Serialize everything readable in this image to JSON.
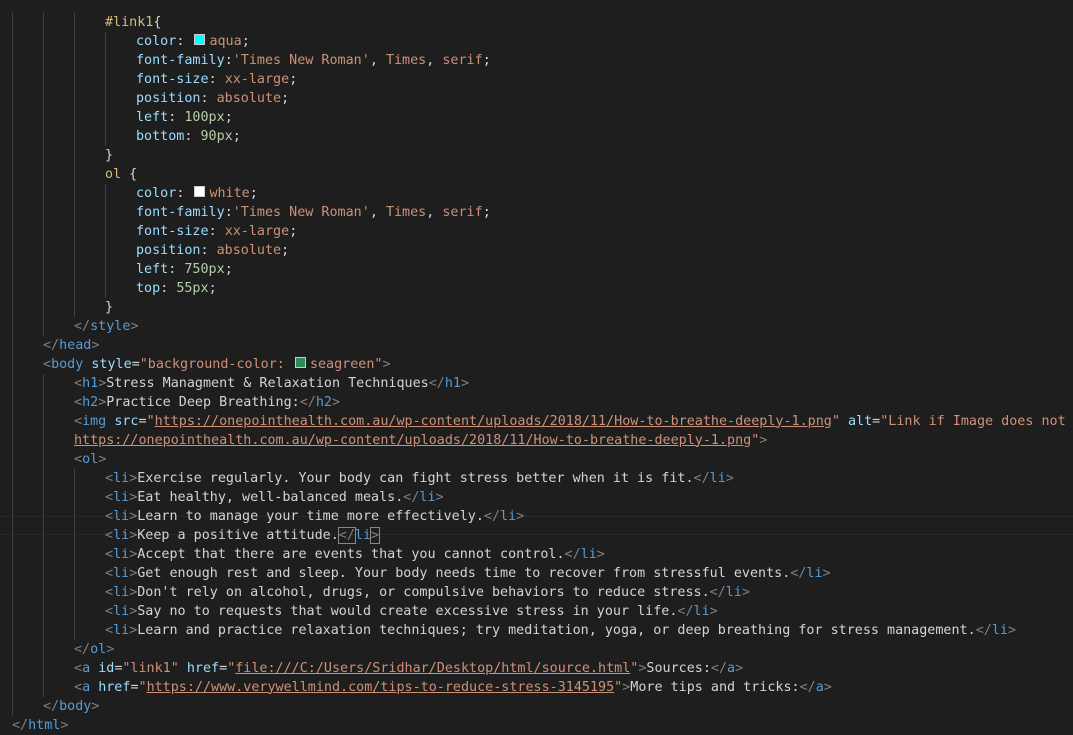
{
  "editor": {
    "lines": [
      {
        "tokens": [
          {
            "t": "#link1",
            "c": "sel"
          },
          {
            "t": "{",
            "c": "txt"
          }
        ]
      },
      {
        "tokens": [
          {
            "t": "color",
            "c": "prop"
          },
          {
            "t": ": ",
            "c": "txt"
          },
          {
            "swatch": "#00ffff"
          },
          {
            "t": "aqua",
            "c": "val"
          },
          {
            "t": ";",
            "c": "txt"
          }
        ]
      },
      {
        "tokens": [
          {
            "t": "font-family",
            "c": "prop"
          },
          {
            "t": ":",
            "c": "txt"
          },
          {
            "t": "'Times New Roman'",
            "c": "str"
          },
          {
            "t": ", ",
            "c": "txt"
          },
          {
            "t": "Times",
            "c": "val"
          },
          {
            "t": ", ",
            "c": "txt"
          },
          {
            "t": "serif",
            "c": "val"
          },
          {
            "t": ";",
            "c": "txt"
          }
        ]
      },
      {
        "tokens": [
          {
            "t": "font-size",
            "c": "prop"
          },
          {
            "t": ": ",
            "c": "txt"
          },
          {
            "t": "xx-large",
            "c": "val"
          },
          {
            "t": ";",
            "c": "txt"
          }
        ]
      },
      {
        "tokens": [
          {
            "t": "position",
            "c": "prop"
          },
          {
            "t": ": ",
            "c": "txt"
          },
          {
            "t": "absolute",
            "c": "val"
          },
          {
            "t": ";",
            "c": "txt"
          }
        ]
      },
      {
        "tokens": [
          {
            "t": "left",
            "c": "prop"
          },
          {
            "t": ": ",
            "c": "txt"
          },
          {
            "t": "100px",
            "c": "num"
          },
          {
            "t": ";",
            "c": "txt"
          }
        ]
      },
      {
        "tokens": [
          {
            "t": "bottom",
            "c": "prop"
          },
          {
            "t": ": ",
            "c": "txt"
          },
          {
            "t": "90px",
            "c": "num"
          },
          {
            "t": ";",
            "c": "txt"
          }
        ]
      },
      {
        "tokens": [
          {
            "t": "}",
            "c": "txt"
          }
        ]
      },
      {
        "tokens": [
          {
            "t": "ol",
            "c": "sel"
          },
          {
            "t": " {",
            "c": "txt"
          }
        ]
      },
      {
        "tokens": [
          {
            "t": "color",
            "c": "prop"
          },
          {
            "t": ": ",
            "c": "txt"
          },
          {
            "swatch": "#ffffff"
          },
          {
            "t": "white",
            "c": "val"
          },
          {
            "t": ";",
            "c": "txt"
          }
        ]
      },
      {
        "tokens": [
          {
            "t": "font-family",
            "c": "prop"
          },
          {
            "t": ":",
            "c": "txt"
          },
          {
            "t": "'Times New Roman'",
            "c": "str"
          },
          {
            "t": ", ",
            "c": "txt"
          },
          {
            "t": "Times",
            "c": "val"
          },
          {
            "t": ", ",
            "c": "txt"
          },
          {
            "t": "serif",
            "c": "val"
          },
          {
            "t": ";",
            "c": "txt"
          }
        ]
      },
      {
        "tokens": [
          {
            "t": "font-size",
            "c": "prop"
          },
          {
            "t": ": ",
            "c": "txt"
          },
          {
            "t": "xx-large",
            "c": "val"
          },
          {
            "t": ";",
            "c": "txt"
          }
        ]
      },
      {
        "tokens": [
          {
            "t": "position",
            "c": "prop"
          },
          {
            "t": ": ",
            "c": "txt"
          },
          {
            "t": "absolute",
            "c": "val"
          },
          {
            "t": ";",
            "c": "txt"
          }
        ]
      },
      {
        "tokens": [
          {
            "t": "left",
            "c": "prop"
          },
          {
            "t": ": ",
            "c": "txt"
          },
          {
            "t": "750px",
            "c": "num"
          },
          {
            "t": ";",
            "c": "txt"
          }
        ]
      },
      {
        "tokens": [
          {
            "t": "top",
            "c": "prop"
          },
          {
            "t": ": ",
            "c": "txt"
          },
          {
            "t": "55px",
            "c": "num"
          },
          {
            "t": ";",
            "c": "txt"
          }
        ]
      },
      {
        "tokens": [
          {
            "t": "}",
            "c": "txt"
          }
        ]
      },
      {
        "tokens": [
          {
            "t": "</",
            "c": "pun"
          },
          {
            "t": "style",
            "c": "tag"
          },
          {
            "t": ">",
            "c": "pun"
          }
        ]
      },
      {
        "tokens": [
          {
            "t": "</",
            "c": "pun"
          },
          {
            "t": "head",
            "c": "tag"
          },
          {
            "t": ">",
            "c": "pun"
          }
        ]
      },
      {
        "tokens": [
          {
            "t": "<",
            "c": "pun"
          },
          {
            "t": "body",
            "c": "tag"
          },
          {
            "t": " ",
            "c": "txt"
          },
          {
            "t": "style",
            "c": "attr"
          },
          {
            "t": "=",
            "c": "txt"
          },
          {
            "t": "\"background-color: ",
            "c": "str"
          },
          {
            "swatch": "#2e8b57"
          },
          {
            "t": "seagreen\"",
            "c": "str"
          },
          {
            "t": ">",
            "c": "pun"
          }
        ]
      },
      {
        "tokens": [
          {
            "t": "<",
            "c": "pun"
          },
          {
            "t": "h1",
            "c": "tag"
          },
          {
            "t": ">",
            "c": "pun"
          },
          {
            "t": "Stress Managment & Relaxation Techniques",
            "c": "txt"
          },
          {
            "t": "</",
            "c": "pun"
          },
          {
            "t": "h1",
            "c": "tag"
          },
          {
            "t": ">",
            "c": "pun"
          }
        ]
      },
      {
        "tokens": [
          {
            "t": "<",
            "c": "pun"
          },
          {
            "t": "h2",
            "c": "tag"
          },
          {
            "t": ">",
            "c": "pun"
          },
          {
            "t": "Practice Deep Breathing:",
            "c": "txt"
          },
          {
            "t": "</",
            "c": "pun"
          },
          {
            "t": "h2",
            "c": "tag"
          },
          {
            "t": ">",
            "c": "pun"
          }
        ]
      },
      {
        "tokens": [
          {
            "t": "<",
            "c": "pun"
          },
          {
            "t": "img",
            "c": "tag"
          },
          {
            "t": " ",
            "c": "txt"
          },
          {
            "t": "src",
            "c": "attr"
          },
          {
            "t": "=",
            "c": "txt"
          },
          {
            "t": "\"",
            "c": "str"
          },
          {
            "t": "https://onepointhealth.com.au/wp-content/uploads/2018/11/How-to-breathe-deeply-1.png",
            "c": "str link"
          },
          {
            "t": "\"",
            "c": "str"
          },
          {
            "t": " ",
            "c": "txt"
          },
          {
            "t": "alt",
            "c": "attr"
          },
          {
            "t": "=",
            "c": "txt"
          },
          {
            "t": "\"Link if Image does not show:",
            "c": "str"
          }
        ]
      },
      {
        "tokens": [
          {
            "t": "https://onepointhealth.com.au/wp-content/uploads/2018/11/How-to-breathe-deeply-1.png",
            "c": "str link"
          },
          {
            "t": "\"",
            "c": "str"
          },
          {
            "t": ">",
            "c": "pun"
          }
        ]
      },
      {
        "tokens": [
          {
            "t": "<",
            "c": "pun"
          },
          {
            "t": "ol",
            "c": "tag"
          },
          {
            "t": ">",
            "c": "pun"
          }
        ]
      },
      {
        "tokens": [
          {
            "t": "<",
            "c": "pun"
          },
          {
            "t": "li",
            "c": "tag"
          },
          {
            "t": ">",
            "c": "pun"
          },
          {
            "t": "Exercise regularly. Your body can fight stress better when it is fit.",
            "c": "txt"
          },
          {
            "t": "</",
            "c": "pun"
          },
          {
            "t": "li",
            "c": "tag"
          },
          {
            "t": ">",
            "c": "pun"
          }
        ]
      },
      {
        "tokens": [
          {
            "t": "<",
            "c": "pun"
          },
          {
            "t": "li",
            "c": "tag"
          },
          {
            "t": ">",
            "c": "pun"
          },
          {
            "t": "Eat healthy, well-balanced meals.",
            "c": "txt"
          },
          {
            "t": "</",
            "c": "pun"
          },
          {
            "t": "li",
            "c": "tag"
          },
          {
            "t": ">",
            "c": "pun"
          }
        ]
      },
      {
        "tokens": [
          {
            "t": "<",
            "c": "pun"
          },
          {
            "t": "li",
            "c": "tag"
          },
          {
            "t": ">",
            "c": "pun"
          },
          {
            "t": "Learn to manage your time more effectively.",
            "c": "txt"
          },
          {
            "t": "</",
            "c": "pun"
          },
          {
            "t": "li",
            "c": "tag"
          },
          {
            "t": ">",
            "c": "pun"
          }
        ]
      },
      {
        "tokens": [
          {
            "t": "<",
            "c": "pun"
          },
          {
            "t": "li",
            "c": "tag"
          },
          {
            "t": ">",
            "c": "pun"
          },
          {
            "t": "Keep a positive attitude.",
            "c": "txt"
          },
          {
            "t": "</",
            "c": "pun bm"
          },
          {
            "t": "li",
            "c": "tag"
          },
          {
            "t": ">",
            "c": "pun bm"
          }
        ]
      },
      {
        "tokens": [
          {
            "t": "<",
            "c": "pun"
          },
          {
            "t": "li",
            "c": "tag"
          },
          {
            "t": ">",
            "c": "pun"
          },
          {
            "t": "Accept that there are events that you cannot control.",
            "c": "txt"
          },
          {
            "t": "</",
            "c": "pun"
          },
          {
            "t": "li",
            "c": "tag"
          },
          {
            "t": ">",
            "c": "pun"
          }
        ]
      },
      {
        "tokens": [
          {
            "t": "<",
            "c": "pun"
          },
          {
            "t": "li",
            "c": "tag"
          },
          {
            "t": ">",
            "c": "pun"
          },
          {
            "t": "Get enough rest and sleep. Your body needs time to recover from stressful events.",
            "c": "txt"
          },
          {
            "t": "</",
            "c": "pun"
          },
          {
            "t": "li",
            "c": "tag"
          },
          {
            "t": ">",
            "c": "pun"
          }
        ]
      },
      {
        "tokens": [
          {
            "t": "<",
            "c": "pun"
          },
          {
            "t": "li",
            "c": "tag"
          },
          {
            "t": ">",
            "c": "pun"
          },
          {
            "t": "Don't rely on alcohol, drugs, or compulsive behaviors to reduce stress.",
            "c": "txt"
          },
          {
            "t": "</",
            "c": "pun"
          },
          {
            "t": "li",
            "c": "tag"
          },
          {
            "t": ">",
            "c": "pun"
          }
        ]
      },
      {
        "tokens": [
          {
            "t": "<",
            "c": "pun"
          },
          {
            "t": "li",
            "c": "tag"
          },
          {
            "t": ">",
            "c": "pun"
          },
          {
            "t": "Say no to requests that would create excessive stress in your life.",
            "c": "txt"
          },
          {
            "t": "</",
            "c": "pun"
          },
          {
            "t": "li",
            "c": "tag"
          },
          {
            "t": ">",
            "c": "pun"
          }
        ]
      },
      {
        "tokens": [
          {
            "t": "<",
            "c": "pun"
          },
          {
            "t": "li",
            "c": "tag"
          },
          {
            "t": ">",
            "c": "pun"
          },
          {
            "t": "Learn and practice relaxation techniques; try meditation, yoga, or deep breathing for stress management.",
            "c": "txt"
          },
          {
            "t": "</",
            "c": "pun"
          },
          {
            "t": "li",
            "c": "tag"
          },
          {
            "t": ">",
            "c": "pun"
          }
        ]
      },
      {
        "tokens": [
          {
            "t": "</",
            "c": "pun"
          },
          {
            "t": "ol",
            "c": "tag"
          },
          {
            "t": ">",
            "c": "pun"
          }
        ]
      },
      {
        "tokens": [
          {
            "t": "<",
            "c": "pun"
          },
          {
            "t": "a",
            "c": "tag"
          },
          {
            "t": " ",
            "c": "txt"
          },
          {
            "t": "id",
            "c": "attr"
          },
          {
            "t": "=",
            "c": "txt"
          },
          {
            "t": "\"link1\"",
            "c": "str"
          },
          {
            "t": " ",
            "c": "txt"
          },
          {
            "t": "href",
            "c": "attr"
          },
          {
            "t": "=",
            "c": "txt"
          },
          {
            "t": "\"",
            "c": "str"
          },
          {
            "t": "file:///C:/Users/Sridhar/Desktop/html/source.html",
            "c": "str link"
          },
          {
            "t": "\"",
            "c": "str"
          },
          {
            "t": ">",
            "c": "pun"
          },
          {
            "t": "Sources:",
            "c": "txt"
          },
          {
            "t": "</",
            "c": "pun"
          },
          {
            "t": "a",
            "c": "tag"
          },
          {
            "t": ">",
            "c": "pun"
          }
        ]
      },
      {
        "tokens": [
          {
            "t": "<",
            "c": "pun"
          },
          {
            "t": "a",
            "c": "tag"
          },
          {
            "t": " ",
            "c": "txt"
          },
          {
            "t": "href",
            "c": "attr"
          },
          {
            "t": "=",
            "c": "txt"
          },
          {
            "t": "\"",
            "c": "str"
          },
          {
            "t": "https://www.verywellmind.com/tips-to-reduce-stress-3145195",
            "c": "str link"
          },
          {
            "t": "\"",
            "c": "str"
          },
          {
            "t": ">",
            "c": "pun"
          },
          {
            "t": "More tips and tricks:",
            "c": "txt"
          },
          {
            "t": "</",
            "c": "pun"
          },
          {
            "t": "a",
            "c": "tag"
          },
          {
            "t": ">",
            "c": "pun"
          }
        ]
      },
      {
        "tokens": [
          {
            "t": "</",
            "c": "pun"
          },
          {
            "t": "body",
            "c": "tag"
          },
          {
            "t": ">",
            "c": "pun"
          }
        ]
      },
      {
        "tokens": [
          {
            "t": "</",
            "c": "pun"
          },
          {
            "t": "html",
            "c": "tag"
          },
          {
            "t": ">",
            "c": "pun"
          }
        ]
      }
    ]
  }
}
